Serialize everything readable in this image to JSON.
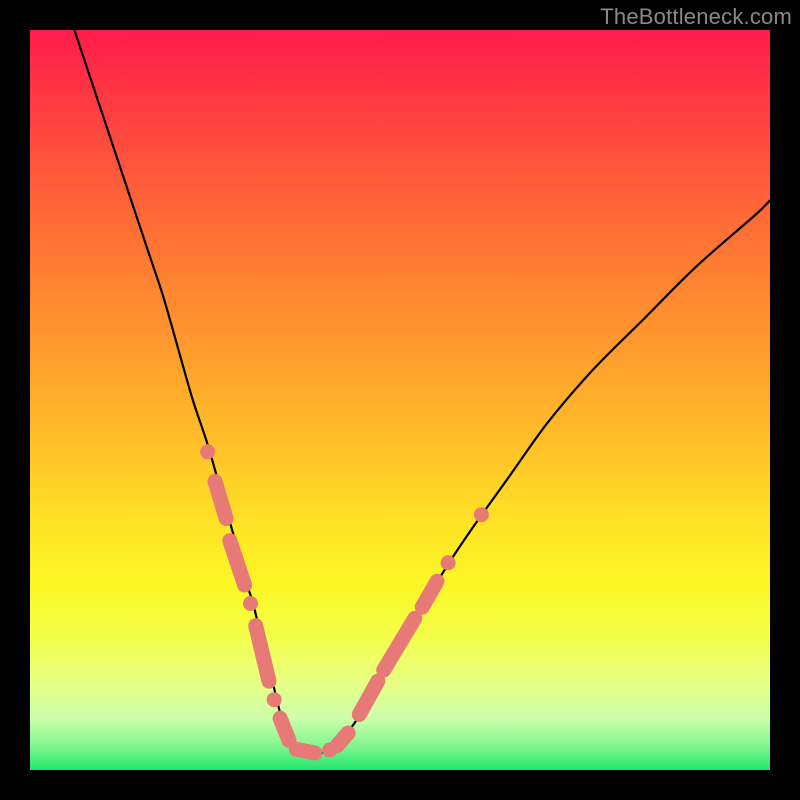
{
  "watermark": {
    "text": "TheBottleneck.com"
  },
  "colors": {
    "curve_stroke": "#000000",
    "marker_fill": "#e77a76",
    "marker_stroke": "#e77a76"
  },
  "chart_data": {
    "type": "line",
    "title": "",
    "xlabel": "",
    "ylabel": "",
    "xlim": [
      0,
      100
    ],
    "ylim": [
      0,
      100
    ],
    "grid": false,
    "series": [
      {
        "name": "bottleneck-curve",
        "x": [
          6,
          8,
          10,
          12,
          14,
          16,
          18,
          20,
          22,
          24,
          26,
          28,
          29,
          30,
          31,
          32,
          33,
          34,
          35,
          36,
          38,
          40,
          42,
          45,
          48,
          52,
          56,
          60,
          65,
          70,
          76,
          83,
          90,
          98,
          100
        ],
        "values": [
          100,
          94,
          88,
          82,
          76,
          70,
          64,
          57,
          50,
          44,
          37,
          30,
          26,
          23,
          19,
          15,
          11,
          7,
          4.5,
          3,
          2.2,
          2.5,
          4,
          8,
          13,
          20,
          27,
          33,
          40,
          47,
          54,
          61,
          68,
          75,
          77
        ]
      }
    ],
    "markers": [
      {
        "shape": "circle",
        "x": 24.0,
        "y": 43.0
      },
      {
        "shape": "capsule",
        "x1": 25.0,
        "y1": 39.0,
        "x2": 26.5,
        "y2": 34.0
      },
      {
        "shape": "capsule",
        "x1": 27.0,
        "y1": 31.0,
        "x2": 29.0,
        "y2": 25.0
      },
      {
        "shape": "circle",
        "x": 29.8,
        "y": 22.5
      },
      {
        "shape": "capsule",
        "x1": 30.5,
        "y1": 19.5,
        "x2": 32.3,
        "y2": 12.0
      },
      {
        "shape": "circle",
        "x": 33.0,
        "y": 9.5
      },
      {
        "shape": "capsule",
        "x1": 33.8,
        "y1": 7.0,
        "x2": 35.0,
        "y2": 4.0
      },
      {
        "shape": "capsule",
        "x1": 36.0,
        "y1": 2.8,
        "x2": 38.5,
        "y2": 2.3
      },
      {
        "shape": "circle",
        "x": 40.5,
        "y": 2.7
      },
      {
        "shape": "capsule",
        "x1": 41.5,
        "y1": 3.3,
        "x2": 43.0,
        "y2": 5.0
      },
      {
        "shape": "capsule",
        "x1": 44.5,
        "y1": 7.5,
        "x2": 47.0,
        "y2": 12.0
      },
      {
        "shape": "capsule",
        "x1": 47.8,
        "y1": 13.5,
        "x2": 52.0,
        "y2": 20.5
      },
      {
        "shape": "capsule",
        "x1": 53.0,
        "y1": 22.0,
        "x2": 55.0,
        "y2": 25.5
      },
      {
        "shape": "circle",
        "x": 56.5,
        "y": 28.0
      },
      {
        "shape": "circle",
        "x": 61.0,
        "y": 34.5
      }
    ]
  }
}
